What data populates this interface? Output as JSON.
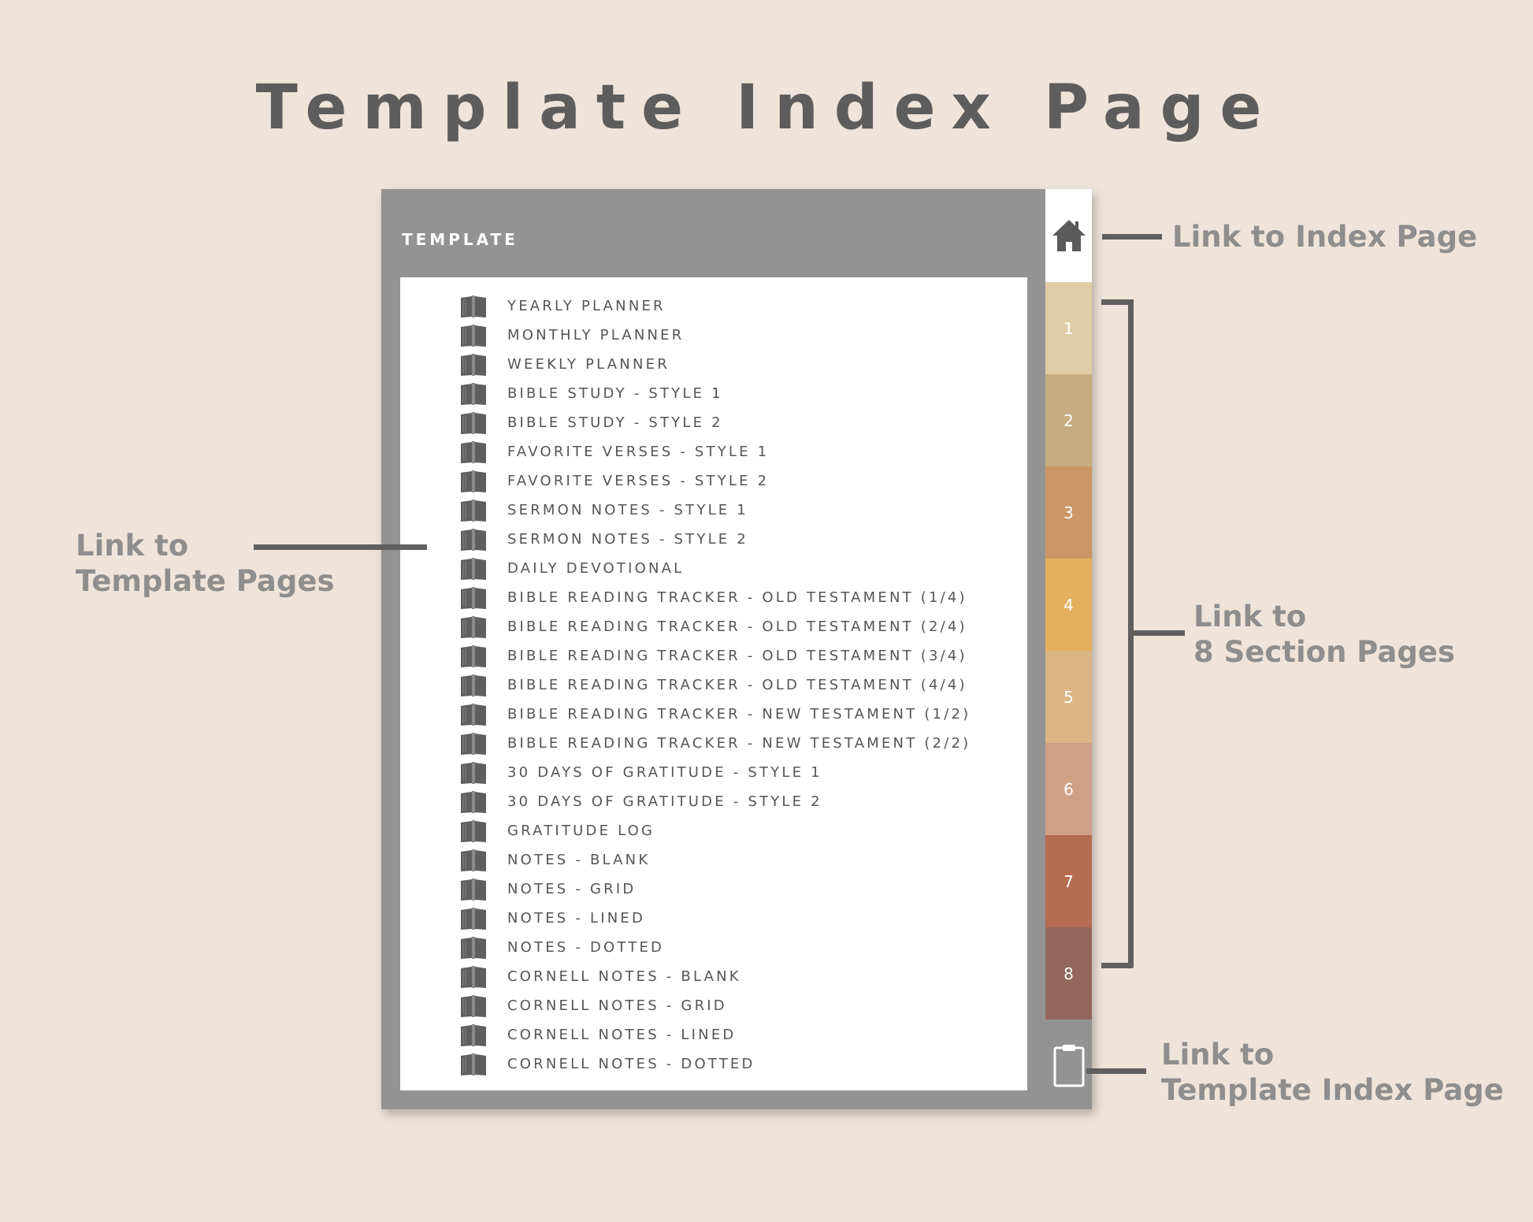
{
  "title": "Template Index Page",
  "device": {
    "header": "TEMPLATE",
    "templates": [
      "YEARLY PLANNER",
      "MONTHLY PLANNER",
      "WEEKLY PLANNER",
      "BIBLE STUDY - STYLE 1",
      "BIBLE STUDY - STYLE 2",
      "FAVORITE VERSES - STYLE 1",
      "FAVORITE VERSES - STYLE 2",
      "SERMON NOTES - STYLE 1",
      "SERMON NOTES - STYLE 2",
      "DAILY DEVOTIONAL",
      "BIBLE READING TRACKER - OLD TESTAMENT (1/4)",
      "BIBLE READING TRACKER - OLD TESTAMENT (2/4)",
      "BIBLE READING TRACKER - OLD TESTAMENT (3/4)",
      "BIBLE READING TRACKER - OLD TESTAMENT (4/4)",
      "BIBLE READING TRACKER - NEW TESTAMENT (1/2)",
      "BIBLE READING TRACKER - NEW TESTAMENT (2/2)",
      "30 DAYS OF GRATITUDE - STYLE 1",
      "30 DAYS OF GRATITUDE - STYLE 2",
      "GRATITUDE LOG",
      "NOTES - BLANK",
      "NOTES - GRID",
      "NOTES - LINED",
      "NOTES - DOTTED",
      "CORNELL NOTES - BLANK",
      "CORNELL NOTES - GRID",
      "CORNELL NOTES - LINED",
      "CORNELL NOTES - DOTTED"
    ],
    "list_icon": "book-icon",
    "home_icon": "home-icon",
    "clipboard_icon": "clipboard-icon",
    "tabs": [
      {
        "label": "1",
        "color": "#dfcea5"
      },
      {
        "label": "2",
        "color": "#c7ac7f"
      },
      {
        "label": "3",
        "color": "#cc9766"
      },
      {
        "label": "4",
        "color": "#e4b05f"
      },
      {
        "label": "5",
        "color": "#dbb486"
      },
      {
        "label": "6",
        "color": "#cfa085"
      },
      {
        "label": "7",
        "color": "#b66c50"
      },
      {
        "label": "8",
        "color": "#91675a"
      }
    ]
  },
  "annotations": {
    "index_page": "Link to Index Page",
    "template_pages_line1": "Link to",
    "template_pages_line2": "Template Pages",
    "section_pages_line1": "Link to",
    "section_pages_line2": "8 Section Pages",
    "template_index_line1": "Link to",
    "template_index_line2": "Template Index Page"
  }
}
